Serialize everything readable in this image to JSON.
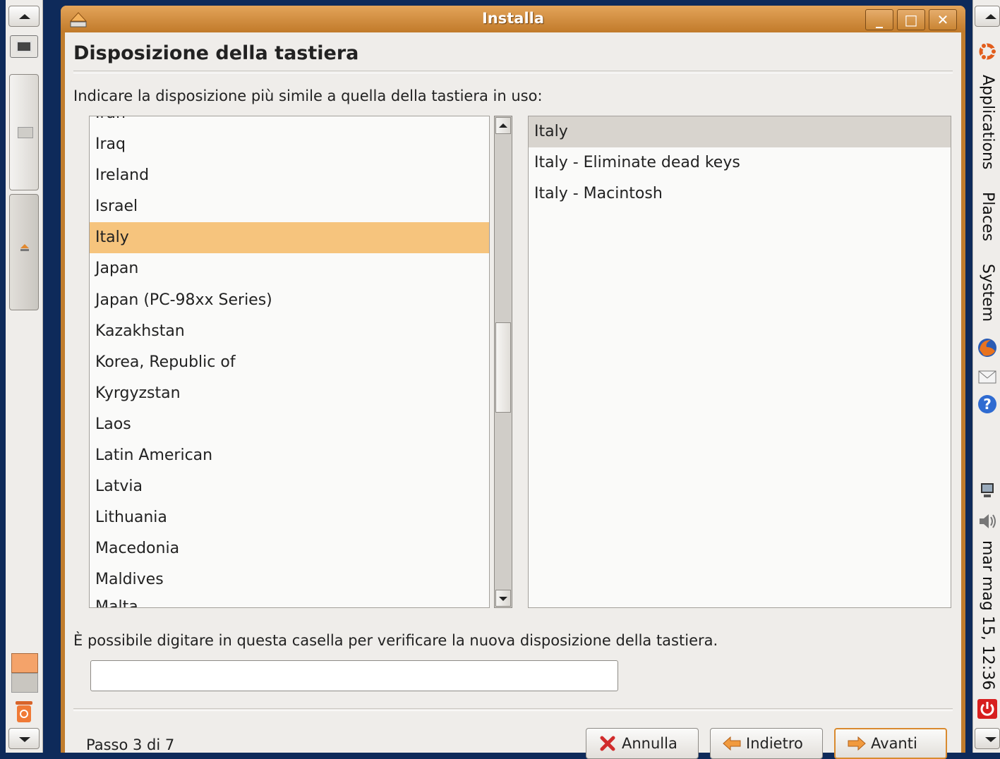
{
  "window": {
    "title": "Installa",
    "minimize_label": "_",
    "maximize_label": "□",
    "close_label": "✕"
  },
  "page": {
    "heading": "Disposizione della tastiera",
    "prompt": "Indicare la disposizione più simile a quella della tastiera in uso:",
    "hint": "È possibile digitare in questa casella per verificare la nuova disposizione della tastiera.",
    "step": "Passo 3 di 7"
  },
  "countries": {
    "partial_top": "Iran",
    "items": [
      "Iraq",
      "Ireland",
      "Israel",
      "Italy",
      "Japan",
      "Japan (PC-98xx Series)",
      "Kazakhstan",
      "Korea, Republic of",
      "Kyrgyzstan",
      "Laos",
      "Latin American",
      "Latvia",
      "Lithuania",
      "Macedonia",
      "Maldives"
    ],
    "partial_bottom": "Malta",
    "selected": "Italy"
  },
  "variants": {
    "items": [
      "Italy",
      "Italy - Eliminate dead keys",
      "Italy - Macintosh"
    ],
    "selected": "Italy"
  },
  "test_field": {
    "value": ""
  },
  "buttons": {
    "cancel": "Annulla",
    "back": "Indietro",
    "next": "Avanti"
  },
  "top_panel": {
    "menus": [
      "Applications",
      "Places",
      "System"
    ],
    "clock": "mar mag 15, 12:36"
  },
  "icons": {
    "left_panel": [
      "show-desktop-icon",
      "installer-icon",
      "trash-icon"
    ],
    "right_panel": [
      "ubuntu-logo-icon",
      "firefox-icon",
      "mail-icon",
      "help-icon",
      "network-icon",
      "volume-icon",
      "power-icon"
    ]
  },
  "colors": {
    "accent": "#f6c47d",
    "title_bar": "#c17a2a",
    "desktop": "#0e2a5a"
  }
}
